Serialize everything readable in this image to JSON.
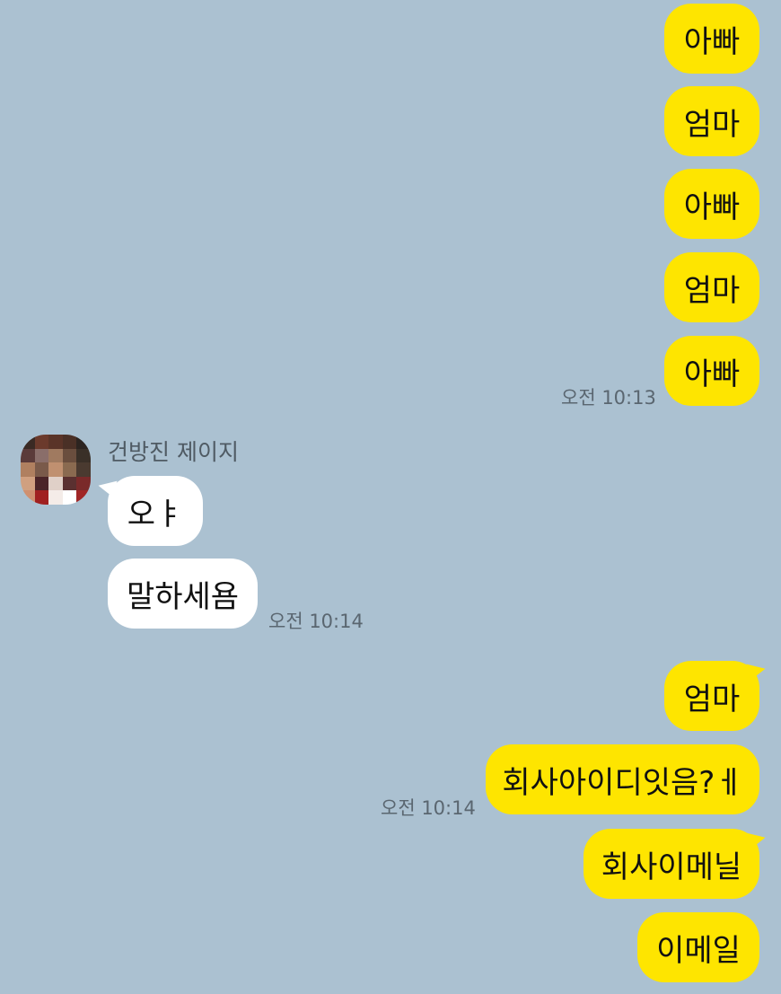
{
  "messages": {
    "m1": "아빠",
    "m2": "엄마",
    "m3": "아빠",
    "m4": "엄마",
    "m5": "아빠",
    "t1": "오전 10:13",
    "sender_name": "건방진 제이지",
    "m6": "오ㅑ",
    "m7": "말하세욤",
    "t2": "오전 10:14",
    "m8": "엄마",
    "m9": "회사아이디잇음?ㅔ",
    "t3": "오전 10:14",
    "m10": "회사이메닐",
    "m11": "이메일"
  },
  "colors": {
    "background": "#abc1d1",
    "my_bubble": "#fee500",
    "their_bubble": "#ffffff",
    "timestamp": "#5a6670"
  },
  "avatar": {
    "icon": "pixelated-profile-avatar",
    "pixels": [
      "#3a2a24",
      "#6b3a2c",
      "#5a3428",
      "#4a3026",
      "#2c2420",
      "#5b3b3a",
      "#8a6e6a",
      "#a07a60",
      "#6a4e3e",
      "#3a3028",
      "#b08060",
      "#7a5a4a",
      "#c09070",
      "#8a6a50",
      "#4a3a30",
      "#d0a080",
      "#4a2428",
      "#e0d0c8",
      "#5a3030",
      "#7a2a2a",
      "#d09070",
      "#a02020",
      "#f4ece8",
      "#ffffff",
      "#a02626"
    ]
  }
}
